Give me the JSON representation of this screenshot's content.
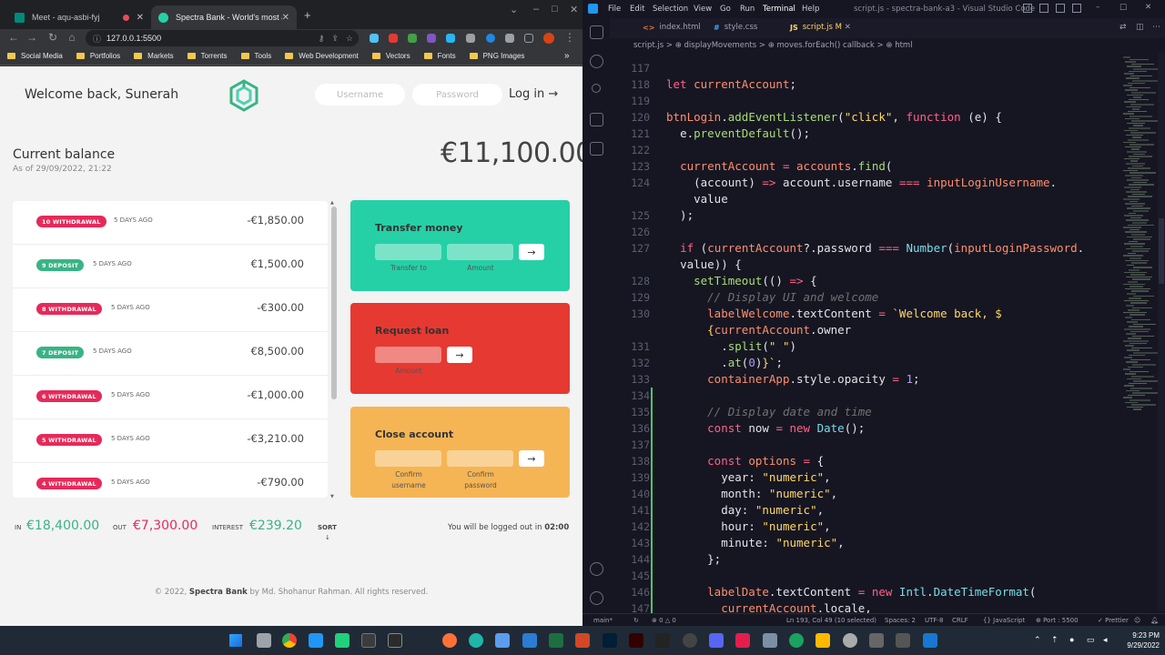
{
  "chrome": {
    "tabs": [
      {
        "title": "Meet - aqu-asbi-fyj",
        "active": false
      },
      {
        "title": "Spectra Bank - World's most aw",
        "active": true
      }
    ],
    "new_tab": "+",
    "url": "127.0.0.1:5500",
    "bookmarks": [
      "Social Media",
      "Portfolios",
      "Markets",
      "Torrents",
      "Tools",
      "Web Development",
      "Vectors",
      "Fonts",
      "PNG Images"
    ],
    "more_bookmarks": "»"
  },
  "bank": {
    "welcome": "Welcome back, Sunerah",
    "username_placeholder": "Username",
    "password_placeholder": "Password",
    "login_label": "Log in →",
    "balance_label": "Current balance",
    "balance_date": "As of 29/09/2022, 21:22",
    "balance_value": "€11,100.00",
    "movements": [
      {
        "type": "10 WITHDRAWAL",
        "kind": "withdrawal",
        "date": "5 DAYS AGO",
        "value": "-€1,850.00"
      },
      {
        "type": "9 DEPOSIT",
        "kind": "deposit",
        "date": "5 DAYS AGO",
        "value": "€1,500.00"
      },
      {
        "type": "8 WITHDRAWAL",
        "kind": "withdrawal",
        "date": "5 DAYS AGO",
        "value": "-€300.00"
      },
      {
        "type": "7 DEPOSIT",
        "kind": "deposit",
        "date": "5 DAYS AGO",
        "value": "€8,500.00"
      },
      {
        "type": "6 WITHDRAWAL",
        "kind": "withdrawal",
        "date": "5 DAYS AGO",
        "value": "-€1,000.00"
      },
      {
        "type": "5 WITHDRAWAL",
        "kind": "withdrawal",
        "date": "5 DAYS AGO",
        "value": "-€3,210.00"
      },
      {
        "type": "4 WITHDRAWAL",
        "kind": "withdrawal",
        "date": "5 DAYS AGO",
        "value": "-€790.00"
      }
    ],
    "transfer": {
      "title": "Transfer money",
      "to_label": "Transfer to",
      "amount_label": "Amount",
      "button": "→"
    },
    "loan": {
      "title": "Request loan",
      "amount_label": "Amount",
      "button": "→"
    },
    "close": {
      "title": "Close account",
      "user_label": "Confirm username",
      "pin_label": "Confirm password",
      "button": "→"
    },
    "summary": {
      "in_label": "IN",
      "in_value": "€18,400.00",
      "out_label": "OUT",
      "out_value": "€7,300.00",
      "interest_label": "INTEREST",
      "interest_value": "€239.20",
      "sort_label": "SORT",
      "sort_arrow": "↓"
    },
    "timer_text": "You will be logged out in",
    "timer_value": "02:00",
    "footer_prefix": "© 2022,",
    "footer_brand": "Spectra Bank",
    "footer_suffix": "by Md. Shohanur Rahman. All rights reserved.",
    "colors": {
      "deposit": "#39b385",
      "withdrawal": "#e52a5a",
      "transfer": "#26d0a6",
      "loan": "#e63932",
      "close": "#f5b554"
    }
  },
  "vscode": {
    "menu": [
      "File",
      "Edit",
      "Selection",
      "View",
      "Go",
      "Run",
      "Terminal",
      "Help"
    ],
    "title": "script.js - spectra-bank-a3 - Visual Studio Code",
    "tabs": [
      {
        "label": "index.html",
        "icon": "<>"
      },
      {
        "label": "style.css",
        "icon": "#"
      },
      {
        "label": "script.js",
        "icon": "JS",
        "badge": "M"
      }
    ],
    "breadcrumb": "script.js > ⊕ displayMovements > ⊕ moves.forEach() callback > ⊕ html",
    "status": {
      "branch": "main*",
      "problems": "⊗ 0 △ 0",
      "position": "Ln 193, Col 49 (10 selected)",
      "spaces": "Spaces: 2",
      "encoding": "UTF-8",
      "eol": "CRLF",
      "language": "{} JavaScript",
      "port": "⊕ Port : 5500",
      "prettier": "✓ Prettier"
    }
  },
  "taskbar": {
    "time": "9:23 PM",
    "date": "9/29/2022"
  }
}
